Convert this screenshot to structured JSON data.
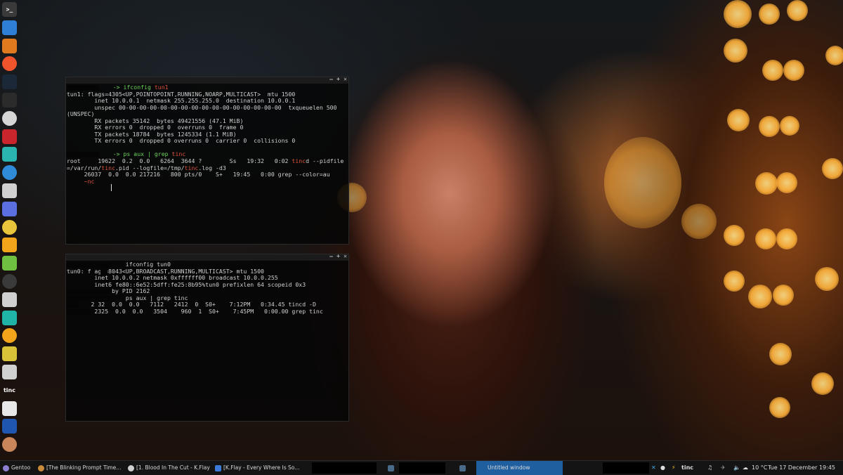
{
  "dock": {
    "items": [
      {
        "name": "terminal-icon",
        "color": "#3a3a3a",
        "glyph": ">_"
      },
      {
        "name": "finder-icon",
        "color": "#2f7fd6",
        "glyph": ""
      },
      {
        "name": "firefox-icon",
        "color": "#e07a1f",
        "glyph": ""
      },
      {
        "name": "brave-icon",
        "color": "#f0542d",
        "glyph": ""
      },
      {
        "name": "steam-icon",
        "color": "#1b2838",
        "glyph": ""
      },
      {
        "name": "android-icon",
        "color": "#2b2b2b",
        "glyph": ""
      },
      {
        "name": "camera-icon",
        "color": "#d6d6d6",
        "glyph": ""
      },
      {
        "name": "wrench-icon",
        "color": "#c8252c",
        "glyph": ""
      },
      {
        "name": "backup-icon",
        "color": "#2bb5b0",
        "glyph": ""
      },
      {
        "name": "shield-icon",
        "color": "#2f8ad8",
        "glyph": ""
      },
      {
        "name": "sync-icon",
        "color": "#d0d0d0",
        "glyph": ""
      },
      {
        "name": "clock-icon",
        "color": "#5b6fe0",
        "glyph": ""
      },
      {
        "name": "notes-icon",
        "color": "#e8c53a",
        "glyph": ""
      },
      {
        "name": "bitcoin-icon",
        "color": "#f2a51a",
        "glyph": ""
      },
      {
        "name": "leaf-icon",
        "color": "#6fbf40",
        "glyph": ""
      },
      {
        "name": "arrow-icon",
        "color": "#3a3a3a",
        "glyph": ""
      },
      {
        "name": "debian-icon",
        "color": "#d0d0d0",
        "glyph": ""
      },
      {
        "name": "circle-icon",
        "color": "#20b3a8",
        "glyph": ""
      },
      {
        "name": "pencil-icon",
        "color": "#f2a51a",
        "glyph": ""
      },
      {
        "name": "face-icon",
        "color": "#d8c23a",
        "glyph": ""
      },
      {
        "name": "compass-icon",
        "color": "#d0d0d0",
        "glyph": ""
      },
      {
        "name": "tinc-logo-icon",
        "color": "#000000",
        "glyph": "tinc"
      },
      {
        "name": "chat-icon",
        "color": "#e8e8e8",
        "glyph": ""
      },
      {
        "name": "playstation-icon",
        "color": "#1e56b0",
        "glyph": ""
      },
      {
        "name": "monkey-icon",
        "color": "#c8865a",
        "glyph": ""
      }
    ]
  },
  "term1": {
    "lines": [
      {
        "a": "",
        "b": "-> ifconfig ",
        "c": "tun1",
        "pre": true
      },
      {
        "a": "tun1: flags=4305<UP,POINTOPOINT,RUNNING,NOARP,MULTICAST>  mtu 1500"
      },
      {
        "a": "        inet 10.0.0.1  netmask 255.255.255.0  destination 10.0.0.1"
      },
      {
        "a": "        unspec 00-00-00-00-00-00-00-00-00-00-00-00-00-00-00-00  txqueuelen 500"
      },
      {
        "a": "(UNSPEC)"
      },
      {
        "a": "        RX packets 35142  bytes 49421556 (47.1 MiB)"
      },
      {
        "a": "        RX errors 0  dropped 0  overruns 0  frame 0"
      },
      {
        "a": "        TX packets 18784  bytes 1245334 (1.1 MiB)"
      },
      {
        "a": "        TX errors 0  dropped 0 overruns 0  carrier 0  collisions 0"
      },
      {
        "a": ""
      },
      {
        "a": "",
        "b": "-> ps aux | grep ",
        "c": "tinc",
        "pre": true
      },
      {
        "a": "root     19622  0.2  0.0   6264  3644 ?        Ss   19:32   0:02 ",
        "c": "tinc",
        "d": "d --pidfile"
      },
      {
        "a": "=/var/run/",
        "c": "tinc",
        "d": ".pid --logfile=/tmp/",
        "c2": "tinc",
        "d2": ".log -d3"
      },
      {
        "a": "     26037  0.0  0.0 217216   800 pts/0    S+   19:45   0:00 grep --color=au"
      },
      {
        "a": "",
        "c": "     ~nc",
        "pre2": true
      }
    ]
  },
  "term2": {
    "lines": [
      {
        "a": "                 ifconfig tun0"
      },
      {
        "a": "tun0: f ags=8043<UP,BROADCAST,RUNNING,MULTICAST> mtu 1500"
      },
      {
        "a": "        inet 10.0.0.2 netmask 0xffffff00 broadcast 10.0.0.255"
      },
      {
        "a": "        inet6 fe80::6e52:5dff:fe25:8b95%tun0 prefixlen 64 scopeid 0x3"
      },
      {
        "a": "          'd by PID 2162"
      },
      {
        "a": "                 ps aux | grep tinc"
      },
      {
        "a": "roo.   2 32  0.0  0.0   7112   2412  0  S0+    7:12PM   0:34.45 tincd -D"
      },
      {
        "a": "        2325  0.0  0.0   3504    960  1  S0+    7:45PM   0:00.00 grep tinc"
      }
    ]
  },
  "taskbar": {
    "start_label": "Gentoo",
    "tasks": [
      {
        "label": "[The Blinking Prompt Time...",
        "icon": "#c98a3a"
      },
      {
        "label": "[1. Blood In The Cut - K.Flay ...",
        "icon": "#d0d0d0"
      },
      {
        "label": "[K.Flay - Every Where Is So...",
        "icon": "#3b7ad6"
      },
      {
        "label": "Untitled window",
        "icon": ""
      }
    ],
    "tray": {
      "tinc": "tinc",
      "weather": "10 °C",
      "clock": "Tue 17 December 19:45"
    }
  }
}
